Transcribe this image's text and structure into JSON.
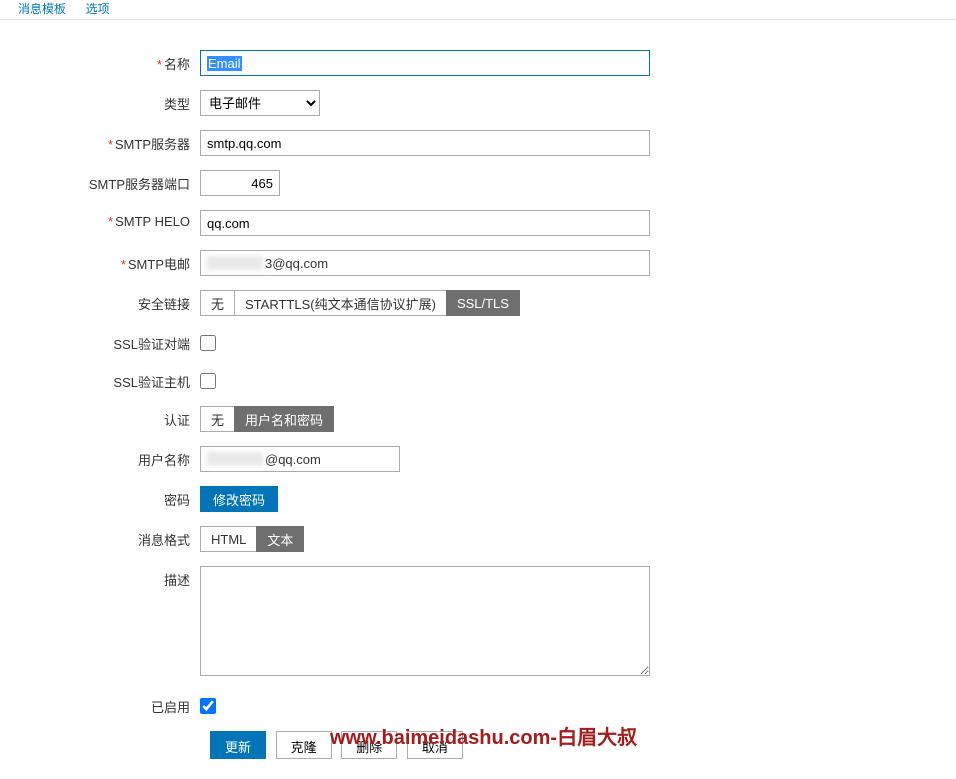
{
  "tabs": {
    "templates": "消息模板",
    "options": "选项"
  },
  "labels": {
    "name": "名称",
    "type": "类型",
    "smtp_server": "SMTP服务器",
    "smtp_port": "SMTP服务器端口",
    "smtp_helo": "SMTP HELO",
    "smtp_email": "SMTP电邮",
    "secure_conn": "安全链接",
    "ssl_peer": "SSL验证对端",
    "ssl_host": "SSL验证主机",
    "auth": "认证",
    "username": "用户名称",
    "password": "密码",
    "msg_format": "消息格式",
    "description": "描述",
    "enabled": "已启用"
  },
  "values": {
    "name": "Email",
    "type": "电子邮件",
    "smtp_server": "smtp.qq.com",
    "smtp_port": "465",
    "smtp_helo": "qq.com",
    "smtp_email_suffix": "3@qq.com",
    "username_suffix": "@qq.com",
    "description": "",
    "enabled": true
  },
  "options": {
    "secure": {
      "none": "无",
      "starttls": "STARTTLS(纯文本通信协议扩展)",
      "ssltls": "SSL/TLS"
    },
    "auth": {
      "none": "无",
      "userpass": "用户名和密码"
    },
    "msgfmt": {
      "html": "HTML",
      "text": "文本"
    }
  },
  "buttons": {
    "change_password": "修改密码",
    "update": "更新",
    "clone": "克隆",
    "delete": "删除",
    "cancel": "取消"
  },
  "watermark": "www.baimeidashu.com-白眉大叔"
}
